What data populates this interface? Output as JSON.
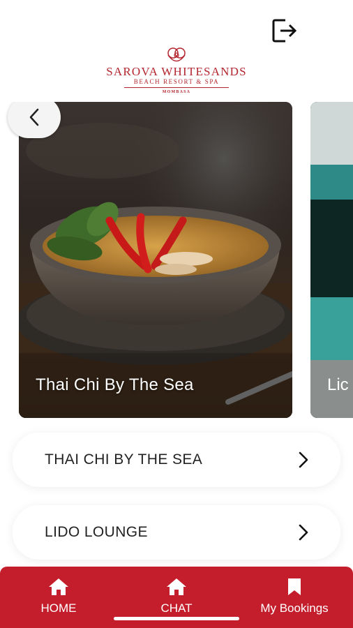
{
  "header": {
    "logout_icon": "logout-icon",
    "logo": {
      "name": "SAROVA WHITESANDS",
      "subtitle": "BEACH RESORT & SPA",
      "city": "MOMBASA"
    }
  },
  "carousel": {
    "back_icon": "chevron-left-icon",
    "cards": [
      {
        "title": "Thai Chi By The Sea"
      },
      {
        "title": "Lido Lounge",
        "visible_text": "Lic"
      }
    ]
  },
  "venues": [
    {
      "label": "THAI CHI BY THE SEA",
      "icon": "chevron-right-icon"
    },
    {
      "label": "LIDO LOUNGE",
      "icon": "chevron-right-icon"
    }
  ],
  "bottom_nav": {
    "items": [
      {
        "label": "HOME",
        "icon": "home-icon"
      },
      {
        "label": "CHAT",
        "icon": "home-icon"
      },
      {
        "label": "My Bookings",
        "icon": "bookmark-icon"
      }
    ],
    "color": "#c41e2c"
  },
  "colors": {
    "brand": "#b3262e",
    "nav": "#c41e2c"
  }
}
